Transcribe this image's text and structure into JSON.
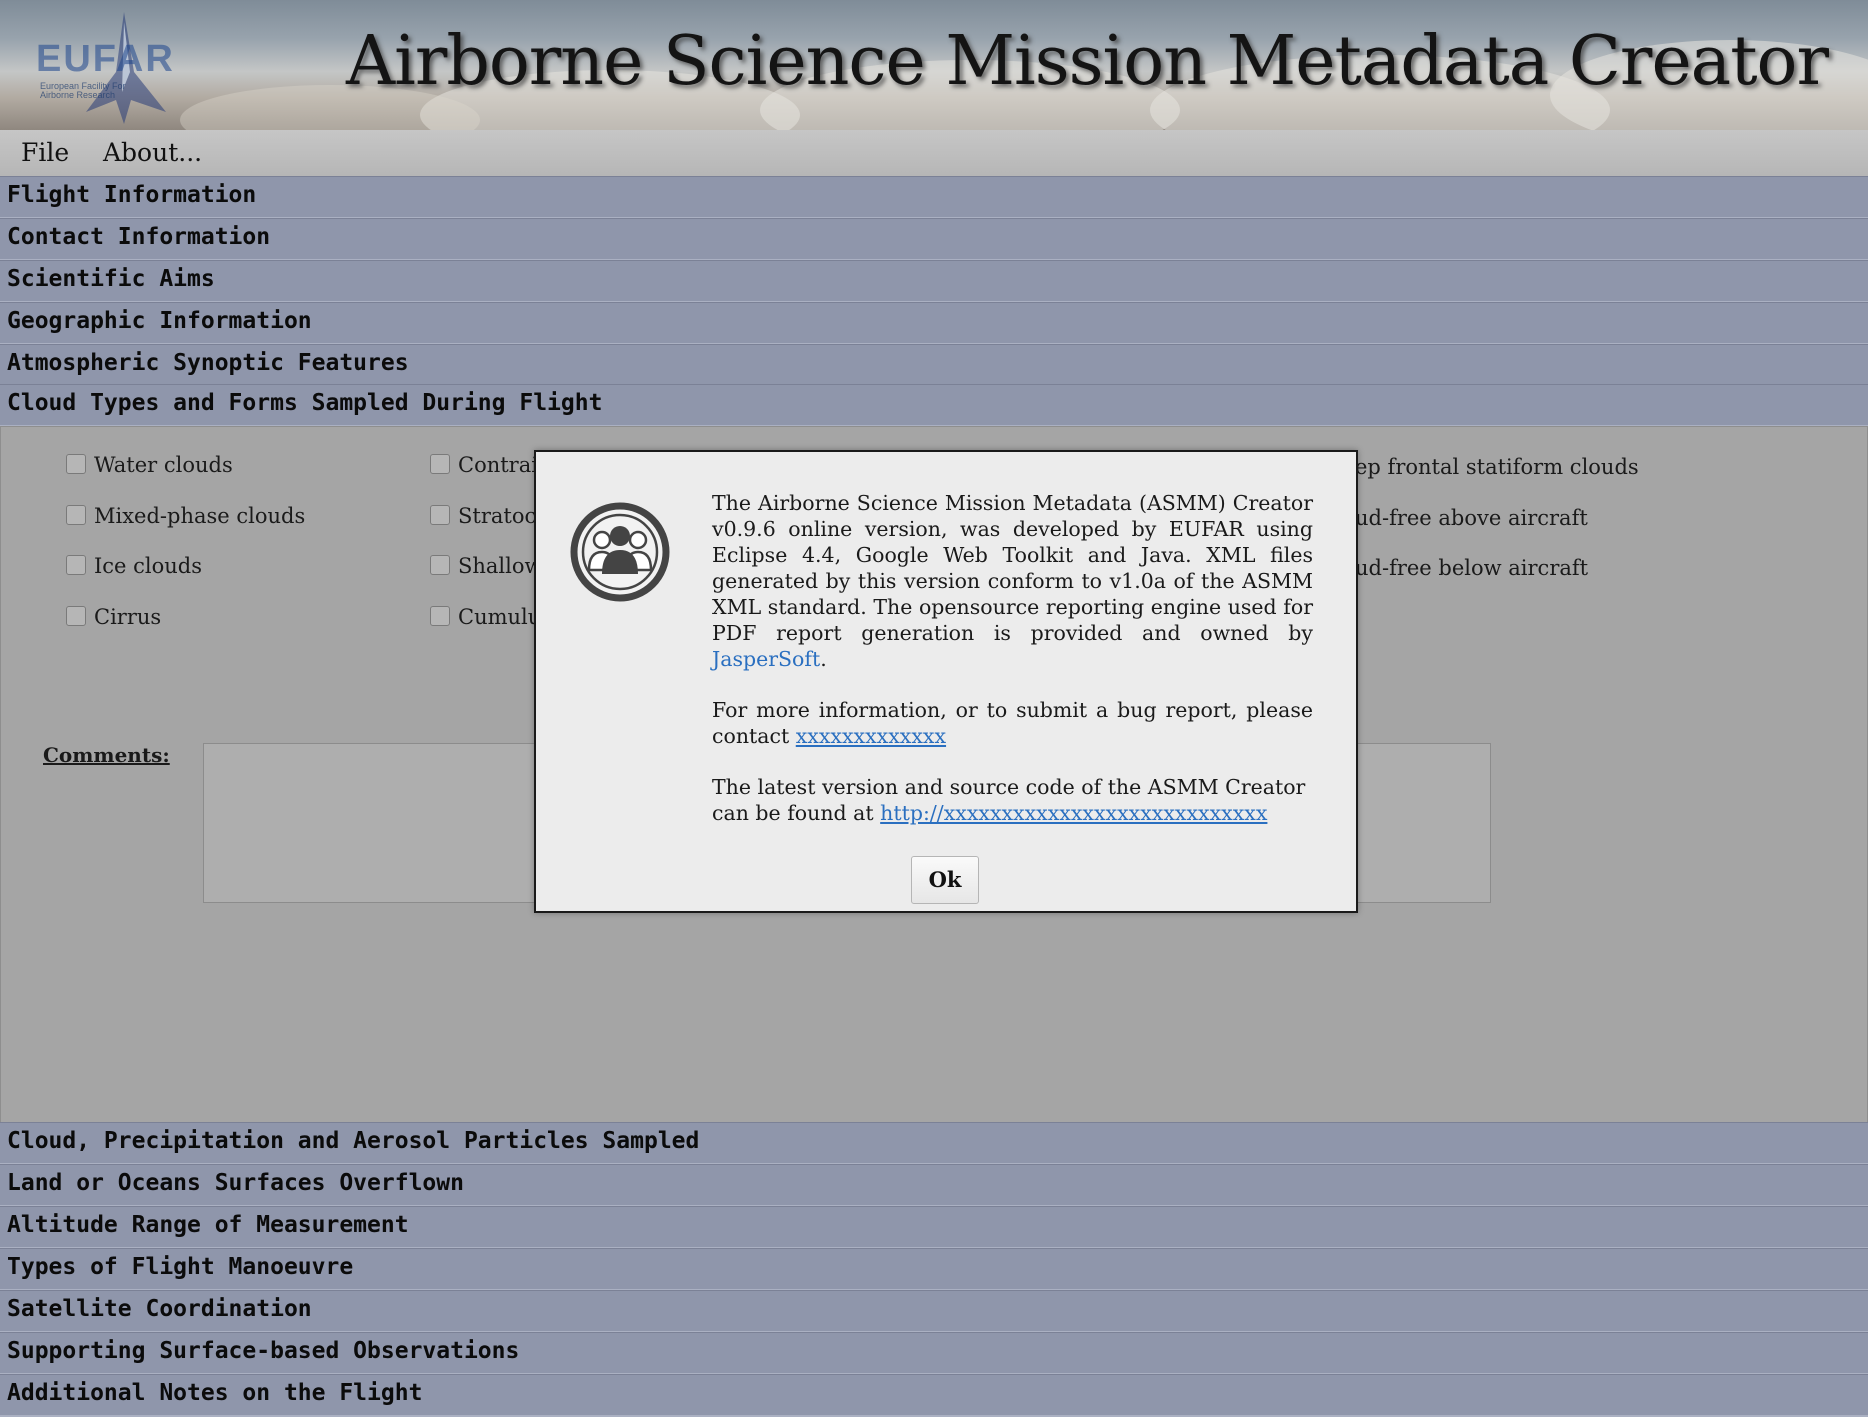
{
  "header": {
    "app_title": "Airborne Science Mission Metadata Creator",
    "logo_text": "EUFAR",
    "logo_subtext": "European Facility For Airborne Research"
  },
  "menu": {
    "file": "File",
    "about": "About..."
  },
  "sections_top": [
    "Flight Information",
    "Contact Information",
    "Scientific Aims",
    "Geographic Information",
    "Atmospheric Synoptic Features",
    "Cloud Types and Forms Sampled During Flight"
  ],
  "cloud_options": {
    "col1": [
      "Water clouds",
      "Mixed-phase clouds",
      "Ice clouds",
      "Cirrus"
    ],
    "col2": [
      "Contrai",
      "Stratoc",
      "Shallow",
      "Cumulu"
    ],
    "col3": [
      "ep frontal statiform clouds",
      "ud-free above aircraft",
      "ud-free below aircraft"
    ]
  },
  "comments_label": "Comments:",
  "sections_bottom": [
    "Cloud, Precipitation and Aerosol Particles Sampled",
    "Land or Oceans Surfaces Overflown",
    "Altitude Range of Measurement",
    "Types of Flight Manoeuvre",
    "Satellite Coordination",
    "Supporting Surface-based Observations",
    "Additional Notes on the Flight"
  ],
  "dialog": {
    "p1_text": "The Airborne Science Mission Metadata (ASMM) Creator v0.9.6 online version, was developed by EUFAR using Eclipse 4.4, Google Web Toolkit and Java. XML files generated by this version conform to v1.0a of the ASMM XML standard. The opensource reporting engine used for PDF report generation is provided and owned by",
    "p1_link": "JasperSoft",
    "p1_end": ".",
    "p2_text": "For more information, or to submit a bug report, please contact",
    "p2_link": "xxxxxxxxxxxxx",
    "p3_text": "The latest version and source code of the ASMM Creator can be found at",
    "p3_link": "http://xxxxxxxxxxxxxxxxxxxxxxxxxxxx",
    "ok_label": "Ok"
  },
  "icons": {
    "dialog_icon": "users-group-icon"
  }
}
